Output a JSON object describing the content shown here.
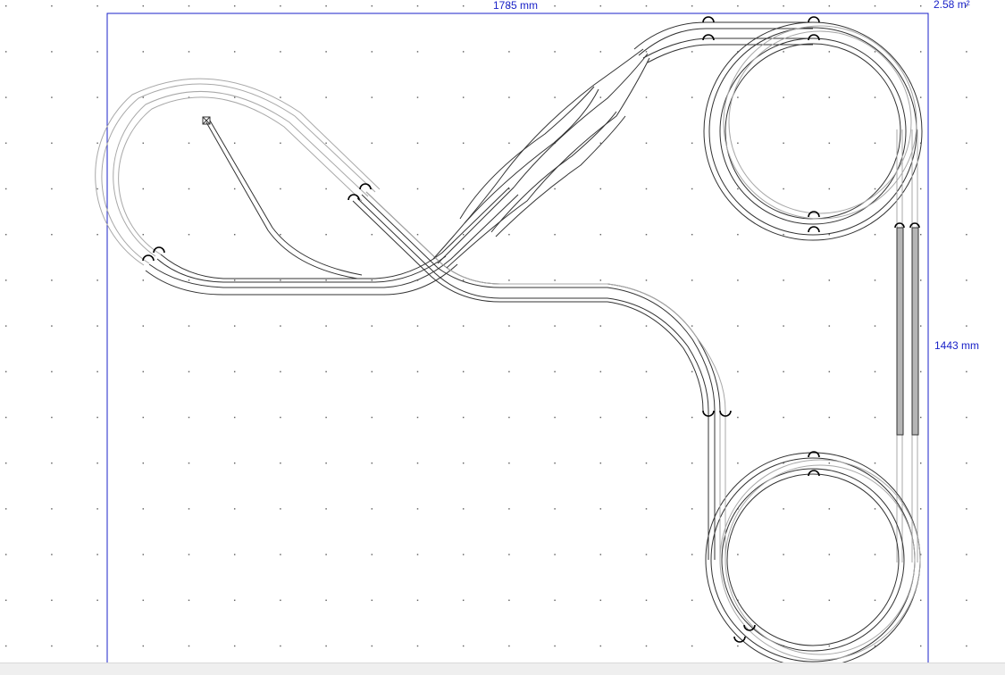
{
  "layout": {
    "width_label": "1785 mm",
    "height_label": "1443 mm",
    "area_label": "2.58 m²"
  },
  "colors": {
    "dimension": "#1a22c8",
    "board_outline": "#1a22c8",
    "grid_dot": "#555555",
    "track_rail": "#333333",
    "track_rail_light": "#a8a8a8",
    "platform": "#b5b5b5"
  },
  "icons": {
    "track_connector": "half-circle-connector-icon",
    "buffer_stop": "buffer-stop-icon"
  }
}
